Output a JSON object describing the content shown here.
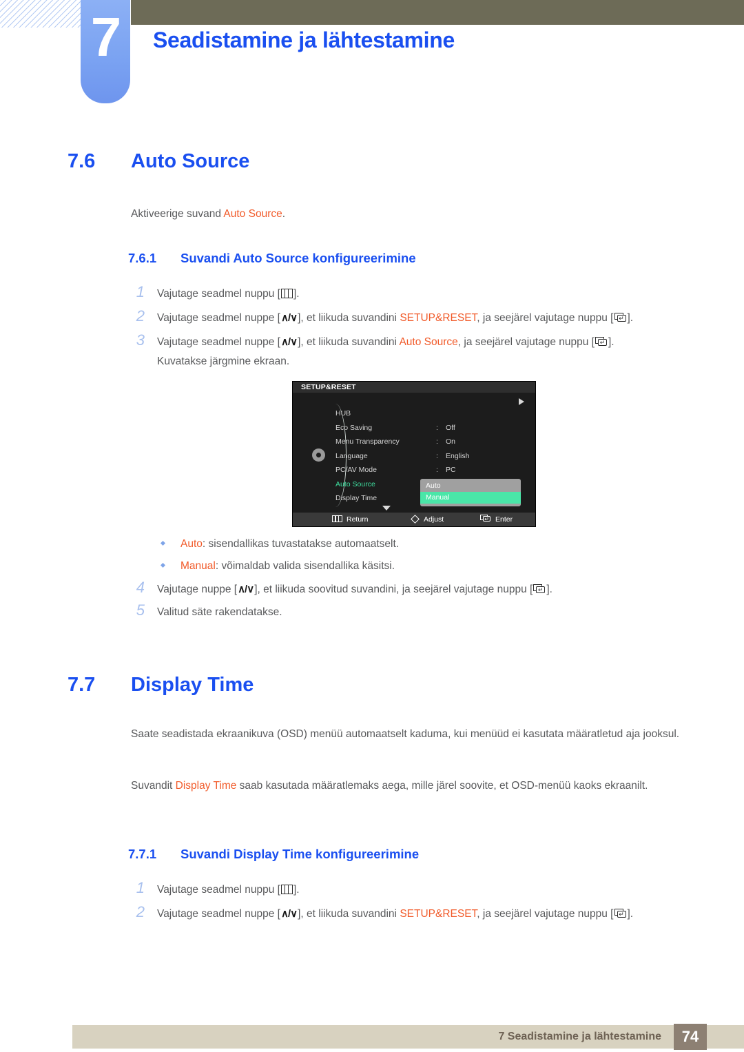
{
  "header": {
    "chapter_number": "7",
    "chapter_title": "Seadistamine ja lähtestamine"
  },
  "sections": {
    "auto_source": {
      "number": "7.6",
      "title": "Auto Source",
      "intro_before": "Aktiveerige suvand ",
      "intro_highlight": "Auto Source",
      "intro_after": ".",
      "sub": {
        "number": "7.6.1",
        "title": "Suvandi Auto Source konfigureerimine"
      },
      "steps": {
        "s1_n": "1",
        "s1_a": "Vajutage seadmel nuppu [",
        "s1_b": "].",
        "s2_n": "2",
        "s2_a": "Vajutage seadmel nuppe [",
        "s2_b": "], et liikuda suvandini ",
        "s2_hl": "SETUP&RESET",
        "s2_c": ", ja seejärel vajutage nuppu [",
        "s2_d": "].",
        "s3_n": "3",
        "s3_a": "Vajutage seadmel nuppe [",
        "s3_b": "], et liikuda suvandini ",
        "s3_hl": "Auto Source",
        "s3_c": ", ja seejärel vajutage nuppu [",
        "s3_d": "].",
        "s3_line2": "Kuvatakse järgmine ekraan.",
        "s4_n": "4",
        "s4_a": "Vajutage nuppe [",
        "s4_b": "], et liikuda soovitud suvandini, ja seejärel vajutage nuppu [",
        "s4_c": "].",
        "s5_n": "5",
        "s5_text": "Valitud säte rakendatakse."
      },
      "bullets": {
        "b1_hl": "Auto",
        "b1_text": ": sisendallikas tuvastatakse automaatselt.",
        "b2_hl": "Manual",
        "b2_text": ": võimaldab valida sisendallika käsitsi."
      }
    },
    "display_time": {
      "number": "7.7",
      "title": "Display Time",
      "para1": "Saate seadistada ekraanikuva (OSD) menüü automaatselt kaduma, kui menüüd ei kasutata määratletud aja jooksul.",
      "para2_before": "Suvandit ",
      "para2_highlight": "Display Time",
      "para2_after": " saab kasutada määratlemaks aega, mille järel soovite, et OSD-menüü kaoks ekraanilt.",
      "sub": {
        "number": "7.7.1",
        "title": "Suvandi Display Time konfigureerimine"
      },
      "steps": {
        "s1_n": "1",
        "s1_a": "Vajutage seadmel nuppu [",
        "s1_b": "].",
        "s2_n": "2",
        "s2_a": "Vajutage seadmel nuppe [",
        "s2_b": "], et liikuda suvandini ",
        "s2_hl": "SETUP&RESET",
        "s2_c": ", ja seejärel vajutage nuppu [",
        "s2_d": "]."
      }
    }
  },
  "osd": {
    "title": "SETUP&RESET",
    "rows": [
      {
        "label": "HUB",
        "colon": "",
        "value": ""
      },
      {
        "label": "Eco Saving",
        "colon": ":",
        "value": "Off"
      },
      {
        "label": "Menu Transparency",
        "colon": ":",
        "value": "On"
      },
      {
        "label": "Language",
        "colon": ":",
        "value": "English"
      },
      {
        "label": "PC/AV Mode",
        "colon": ":",
        "value": "PC"
      },
      {
        "label": "Auto Source",
        "colon": ":",
        "value": ""
      },
      {
        "label": "Display Time",
        "colon": ":",
        "value": ""
      }
    ],
    "dropdown": {
      "options": [
        "Auto",
        "Manual"
      ],
      "selected": "Manual"
    },
    "bottom": {
      "return": "Return",
      "adjust": "Adjust",
      "enter": "Enter"
    },
    "colors": {
      "selected_label": "#3fe0a0",
      "dropdown_highlight": "#4ae6a8",
      "dropdown_bg": "#a0a0a0"
    }
  },
  "footer": {
    "text": "7 Seadistamine ja lähtestamine",
    "page": "74"
  },
  "theme": {
    "heading_blue": "#1a4ff0",
    "highlight_orange": "#f15a29",
    "olive": "#6d6b57",
    "tab_blue": "#7ba3f2",
    "footer_bar": "#d8d2c0",
    "footer_page_bg": "#8d8073"
  }
}
